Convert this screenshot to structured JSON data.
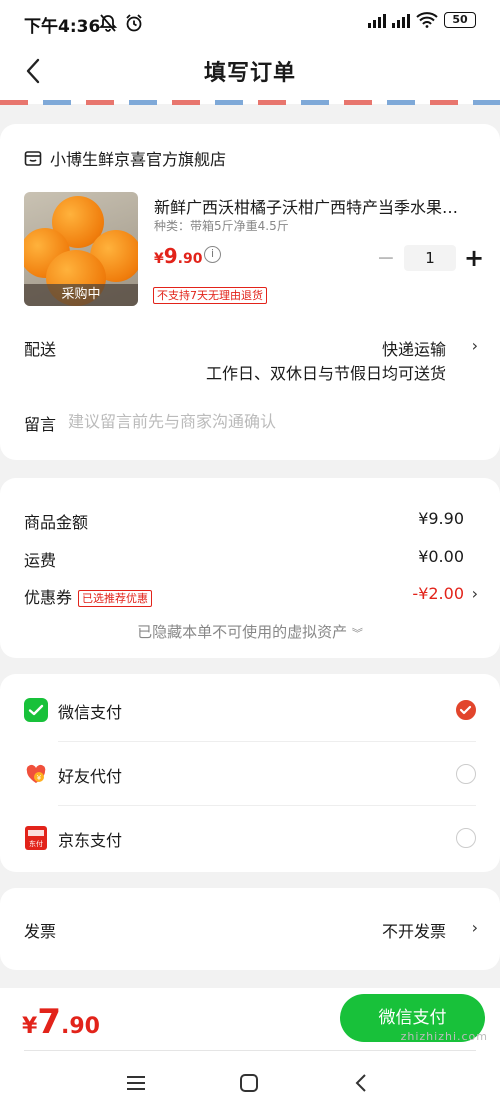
{
  "status_bar": {
    "time": "下午4:36",
    "battery": "50"
  },
  "nav": {
    "title": "填写订单"
  },
  "store": {
    "name": "小博生鲜京喜官方旗舰店"
  },
  "product": {
    "name": "新鲜广西沃柑橘子沃柑广西特产当季水果…",
    "spec": "种类：带箱5斤净重4.5斤",
    "price_symbol": "¥",
    "price_int": "9",
    "price_dec": ".90",
    "image_tag": "采购中",
    "quantity": "1",
    "return_policy": "不支持7天无理由退货"
  },
  "shipping": {
    "label": "配送",
    "method": "快递运输",
    "note": "工作日、双休日与节假日均可送货"
  },
  "message": {
    "label": "留言",
    "placeholder": "建议留言前先与商家沟通确认"
  },
  "summary": {
    "goods_label": "商品金额",
    "goods_value": "¥9.90",
    "freight_label": "运费",
    "freight_value": "¥0.00",
    "coupon_label": "优惠券",
    "coupon_tag": "已选推荐优惠",
    "coupon_value": "-¥2.00",
    "hidden_assets": "已隐藏本单不可使用的虚拟资产"
  },
  "payment": {
    "methods": [
      {
        "label": "微信支付",
        "selected": true
      },
      {
        "label": "好友代付",
        "selected": false
      },
      {
        "label": "京东支付",
        "selected": false
      }
    ],
    "jd_icon_text": "东付"
  },
  "invoice": {
    "label": "发票",
    "value": "不开发票"
  },
  "footer": {
    "total_symbol": "¥",
    "total_int": "7",
    "total_dec": ".90",
    "pay_button": "微信支付"
  },
  "watermark": "zhizhizhi.com",
  "colors": {
    "accent_red": "#e2231a",
    "wechat_green": "#18c13a",
    "radio_selected": "#e2452c"
  }
}
